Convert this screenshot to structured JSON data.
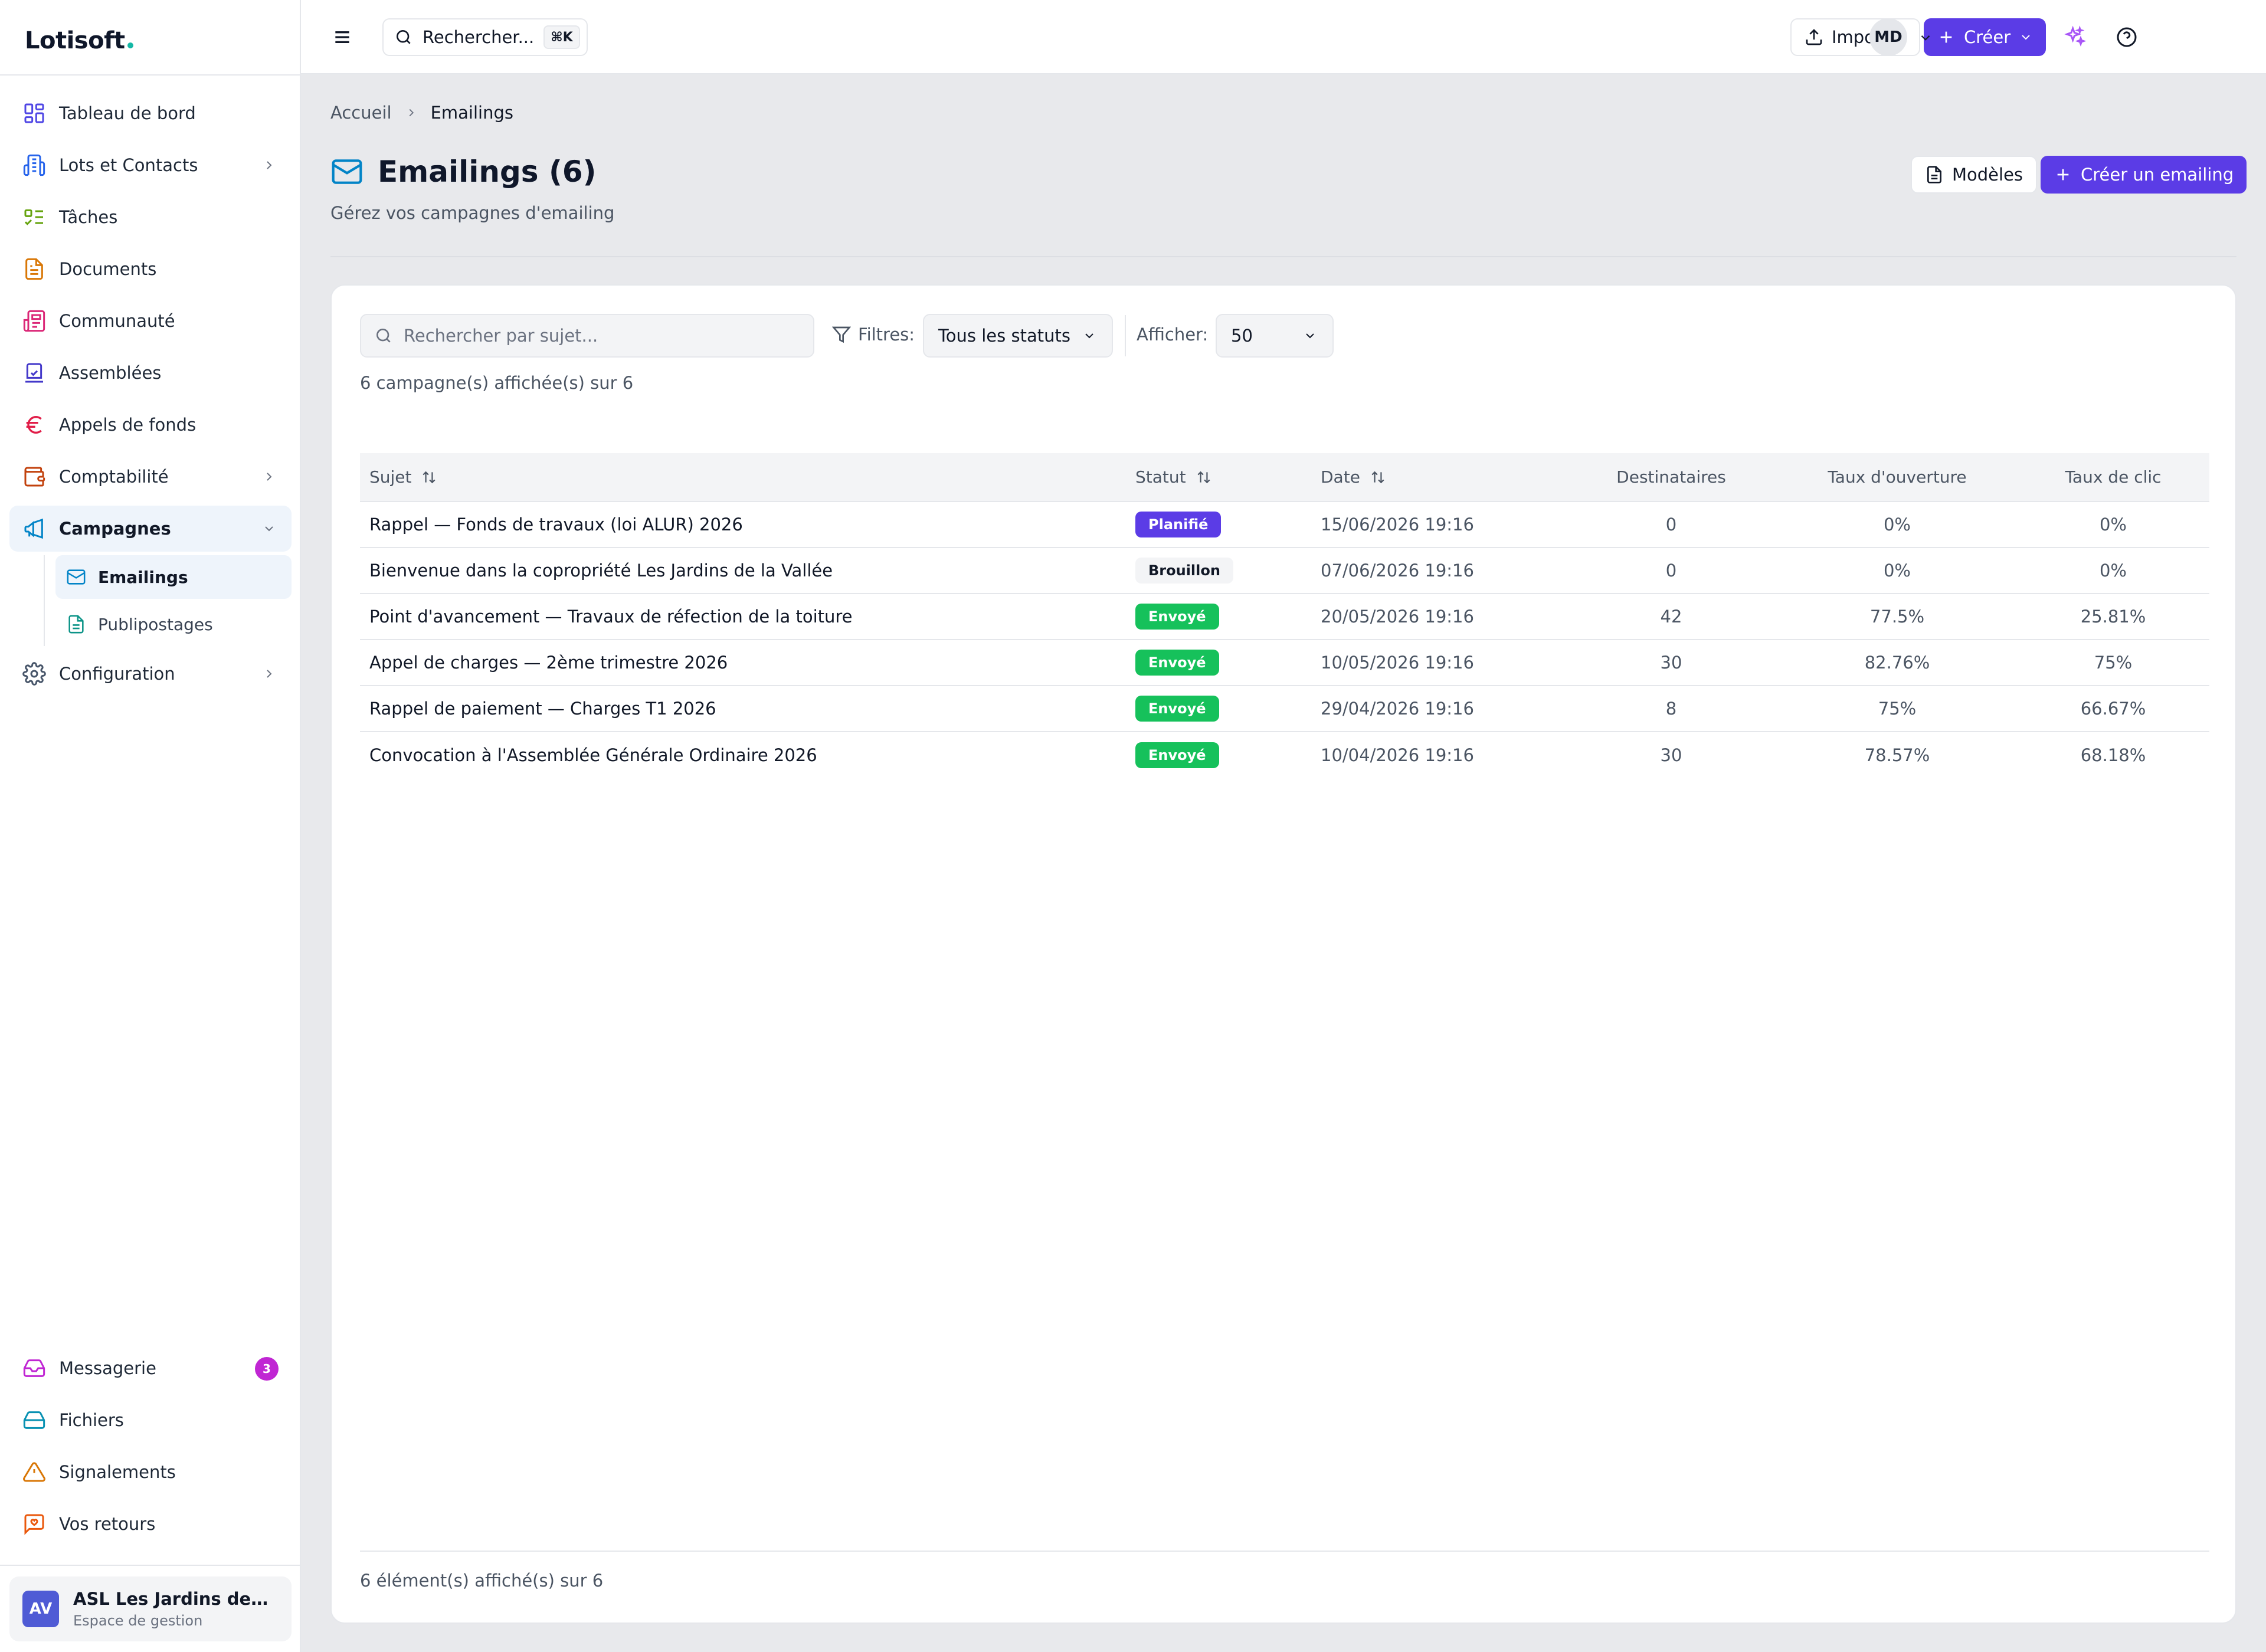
{
  "app": {
    "brand": "Lotisoft"
  },
  "sidebar": {
    "items": [
      {
        "label": "Tableau de bord",
        "icon": "dashboard-icon"
      },
      {
        "label": "Lots et Contacts",
        "icon": "building-icon"
      },
      {
        "label": "Tâches",
        "icon": "tasks-icon"
      },
      {
        "label": "Documents",
        "icon": "document-icon"
      },
      {
        "label": "Communauté",
        "icon": "newspaper-icon"
      },
      {
        "label": "Assemblées",
        "icon": "vote-icon"
      },
      {
        "label": "Appels de fonds",
        "icon": "euro-icon"
      },
      {
        "label": "Comptabilité",
        "icon": "wallet-icon"
      },
      {
        "label": "Campagnes",
        "icon": "megaphone-icon"
      },
      {
        "label": "Configuration",
        "icon": "gear-icon"
      }
    ],
    "sub_items": [
      {
        "label": "Emailings",
        "icon": "mail-icon"
      },
      {
        "label": "Publipostages",
        "icon": "file-text-icon"
      }
    ],
    "bottom_items": [
      {
        "label": "Messagerie",
        "icon": "inbox-icon",
        "badge": "3"
      },
      {
        "label": "Fichiers",
        "icon": "hard-drive-icon"
      },
      {
        "label": "Signalements",
        "icon": "warning-icon"
      },
      {
        "label": "Vos retours",
        "icon": "feedback-icon"
      }
    ],
    "org": {
      "initials": "AV",
      "name": "ASL Les Jardins de la Vallée",
      "subtitle": "Espace de gestion"
    }
  },
  "topbar": {
    "search_label": "Rechercher...",
    "search_shortcut": "⌘K",
    "import_label": "Importer",
    "create_label": "Créer",
    "user_initials": "MD"
  },
  "breadcrumb": {
    "home": "Accueil",
    "current": "Emailings"
  },
  "page": {
    "title": "Emailings (6)",
    "subtitle": "Gérez vos campagnes d'emailing",
    "templates_label": "Modèles",
    "create_label": "Créer un emailing"
  },
  "filters": {
    "search_placeholder": "Rechercher par sujet...",
    "filters_label": "Filtres:",
    "status_value": "Tous les statuts",
    "show_label": "Afficher:",
    "page_size": "50",
    "count_text": "6 campagne(s) affichée(s) sur 6"
  },
  "table": {
    "headers": [
      "Sujet",
      "Statut",
      "Date",
      "Destinataires",
      "Taux d'ouverture",
      "Taux de clic"
    ],
    "rows": [
      {
        "subject": "Rappel — Fonds de travaux (loi ALUR) 2026",
        "status": "Planifié",
        "date": "15/06/2026 19:16",
        "recipients": "0",
        "open_rate": "0%",
        "click_rate": "0%"
      },
      {
        "subject": "Bienvenue dans la copropriété Les Jardins de la Vallée",
        "status": "Brouillon",
        "date": "07/06/2026 19:16",
        "recipients": "0",
        "open_rate": "0%",
        "click_rate": "0%"
      },
      {
        "subject": "Point d'avancement — Travaux de réfection de la toiture",
        "status": "Envoyé",
        "date": "20/05/2026 19:16",
        "recipients": "42",
        "open_rate": "77.5%",
        "click_rate": "25.81%"
      },
      {
        "subject": "Appel de charges — 2ème trimestre 2026",
        "status": "Envoyé",
        "date": "10/05/2026 19:16",
        "recipients": "30",
        "open_rate": "82.76%",
        "click_rate": "75%"
      },
      {
        "subject": "Rappel de paiement — Charges T1 2026",
        "status": "Envoyé",
        "date": "29/04/2026 19:16",
        "recipients": "8",
        "open_rate": "75%",
        "click_rate": "66.67%"
      },
      {
        "subject": "Convocation à l'Assemblée Générale Ordinaire 2026",
        "status": "Envoyé",
        "date": "10/04/2026 19:16",
        "recipients": "30",
        "open_rate": "78.57%",
        "click_rate": "68.18%"
      }
    ],
    "footer": "6 élément(s) affiché(s) sur 6"
  },
  "colors": {
    "primary": "#5b3ce6",
    "sent": "#16c15b",
    "draft": "#f3f4f6",
    "badge": "#c026d3",
    "brand_dot": "#14b8a6"
  }
}
